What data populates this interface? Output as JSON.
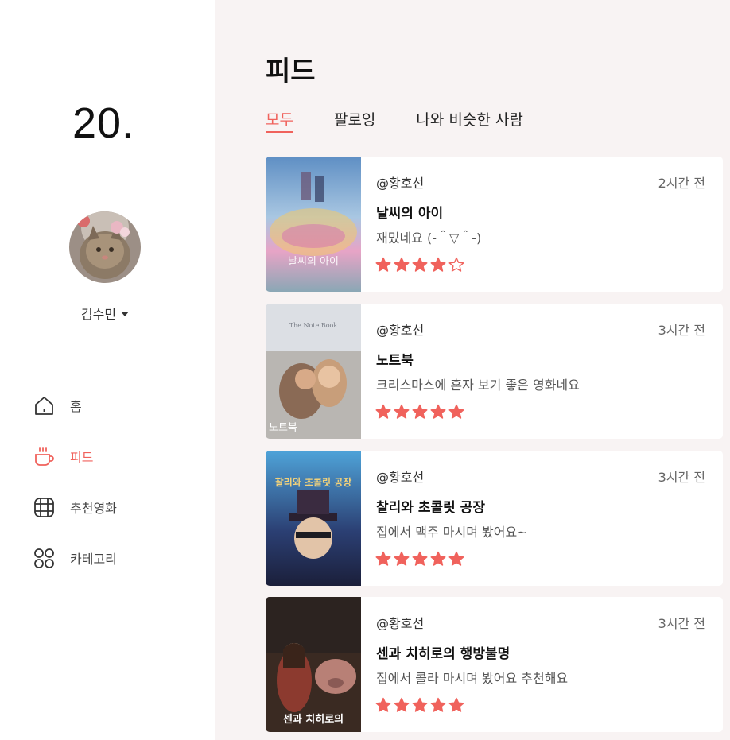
{
  "app": {
    "brand": "20."
  },
  "user": {
    "name": "김수민"
  },
  "nav": [
    {
      "label": "홈",
      "icon": "home-icon"
    },
    {
      "label": "피드",
      "icon": "coffee-cup-icon",
      "active": true
    },
    {
      "label": "추천영화",
      "icon": "film-icon"
    },
    {
      "label": "카테고리",
      "icon": "category-grid-icon"
    }
  ],
  "feed": {
    "title": "피드",
    "tabs": [
      {
        "label": "모두",
        "active": true
      },
      {
        "label": "팔로잉"
      },
      {
        "label": "나와 비슷한 사람"
      }
    ],
    "posts": [
      {
        "user": "@황호선",
        "time": "2시간 전",
        "movie": "날씨의 아이",
        "review": "재밌네요  (-＾▽＾-)",
        "rating": 4,
        "poster_text": "날씨의 아이"
      },
      {
        "user": "@황호선",
        "time": "3시간 전",
        "movie": "노트북",
        "review": "크리스마스에 혼자 보기 좋은 영화네요",
        "rating": 5,
        "poster_text": "노트북"
      },
      {
        "user": "@황호선",
        "time": "3시간 전",
        "movie": "찰리와 초콜릿 공장",
        "review": "집에서 맥주 마시며 봤어요~",
        "rating": 5,
        "poster_text": "찰리와 초콜릿 공장"
      },
      {
        "user": "@황호선",
        "time": "3시간 전",
        "movie": "센과 치히로의 행방불명",
        "review": "집에서 콜라 마시며 봤어요 추천해요",
        "rating": 5,
        "poster_text": "센과 치히로의"
      }
    ]
  },
  "colors": {
    "accent": "#f0625c",
    "main_bg": "#f8f3f3",
    "star": "#f0625c"
  }
}
